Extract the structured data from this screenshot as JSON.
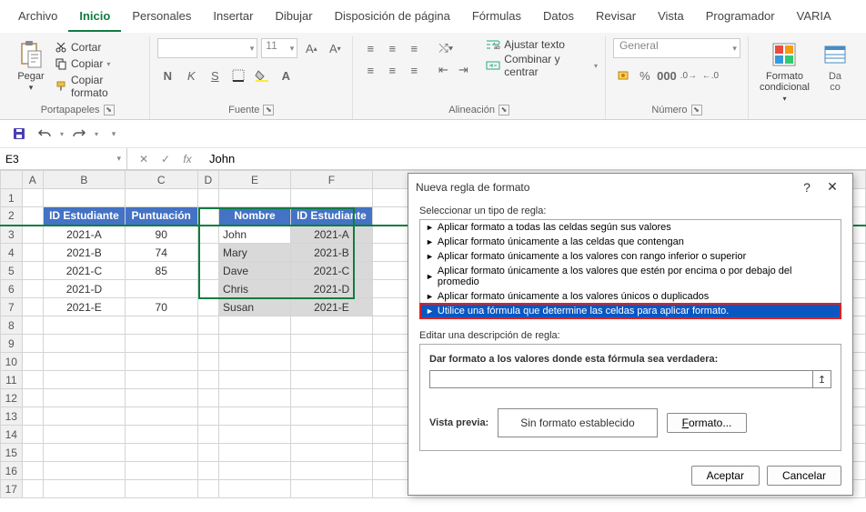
{
  "menu": {
    "items": [
      "Archivo",
      "Inicio",
      "Personales",
      "Insertar",
      "Dibujar",
      "Disposición de página",
      "Fórmulas",
      "Datos",
      "Revisar",
      "Vista",
      "Programador",
      "VARIA"
    ],
    "active": 1
  },
  "ribbon": {
    "paste": "Pegar",
    "cut": "Cortar",
    "copy": "Copiar",
    "format_painter": "Copiar formato",
    "clipboard_label": "Portapapeles",
    "font_size": "11",
    "font_label": "Fuente",
    "wrap_text": "Ajustar texto",
    "merge_center": "Combinar y centrar",
    "align_label": "Alineación",
    "number_format": "General",
    "number_label": "Número",
    "cond_format": "Formato condicional",
    "da": "Da",
    "co": "co"
  },
  "namebox": "E3",
  "formula": "John",
  "columns": [
    "A",
    "B",
    "C",
    "D",
    "E",
    "F"
  ],
  "table1": {
    "headers": [
      "ID Estudiante",
      "Puntuación"
    ],
    "rows": [
      [
        "2021-A",
        "90"
      ],
      [
        "2021-B",
        "74"
      ],
      [
        "2021-C",
        "85"
      ],
      [
        "2021-D",
        ""
      ],
      [
        "2021-E",
        "70"
      ]
    ]
  },
  "table2": {
    "headers": [
      "Nombre",
      "ID Estudiante"
    ],
    "rows": [
      [
        "John",
        "2021-A"
      ],
      [
        "Mary",
        "2021-B"
      ],
      [
        "Dave",
        "2021-C"
      ],
      [
        "Chris",
        "2021-D"
      ],
      [
        "Susan",
        "2021-E"
      ]
    ]
  },
  "dialog": {
    "title": "Nueva regla de formato",
    "select_label": "Seleccionar un tipo de regla:",
    "rules": [
      "Aplicar formato a todas las celdas según sus valores",
      "Aplicar formato únicamente a las celdas que contengan",
      "Aplicar formato únicamente a los valores con rango inferior o superior",
      "Aplicar formato únicamente a los valores que estén por encima o por debajo del promedio",
      "Aplicar formato únicamente a los valores únicos o duplicados",
      "Utilice una fórmula que determine las celdas para aplicar formato."
    ],
    "selected_rule": 5,
    "edit_label": "Editar una descripción de regla:",
    "formula_label": "Dar formato a los valores donde esta fórmula sea verdadera:",
    "formula_value": "",
    "preview_label": "Vista previa:",
    "preview_text": "Sin formato establecido",
    "format_btn": "Formato...",
    "ok": "Aceptar",
    "cancel": "Cancelar"
  }
}
